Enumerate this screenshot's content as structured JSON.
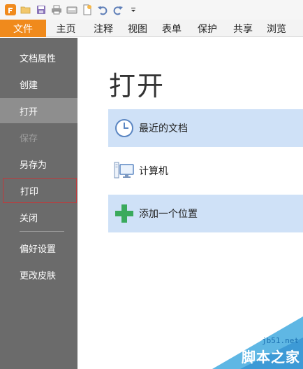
{
  "quick_access": {
    "icons": [
      "app-logo-icon",
      "open-folder-icon",
      "save-disk-icon",
      "print-icon",
      "scan-icon",
      "new-doc-icon",
      "undo-icon",
      "redo-icon",
      "customize-dropdown-icon"
    ]
  },
  "ribbon": {
    "tabs": [
      {
        "label": "文件",
        "active": true
      },
      {
        "label": "主页"
      },
      {
        "label": "注释"
      },
      {
        "label": "视图"
      },
      {
        "label": "表单"
      },
      {
        "label": "保护"
      },
      {
        "label": "共享"
      },
      {
        "label": "浏览"
      }
    ]
  },
  "sidebar": {
    "items": [
      {
        "label": "文档属性"
      },
      {
        "label": "创建"
      },
      {
        "label": "打开",
        "state": "active"
      },
      {
        "label": "保存",
        "state": "disabled"
      },
      {
        "label": "另存为"
      },
      {
        "label": "打印",
        "state": "highlighted"
      },
      {
        "label": "关闭"
      },
      {
        "label": "偏好设置"
      },
      {
        "label": "更改皮肤"
      }
    ]
  },
  "main": {
    "title": "打开",
    "options": [
      {
        "label": "最近的文档",
        "icon": "clock-icon"
      },
      {
        "label": "计算机",
        "icon": "computer-icon"
      },
      {
        "label": "添加一个位置",
        "icon": "plus-icon"
      }
    ]
  },
  "watermark": {
    "url": "jb51.net",
    "name": "脚本之家"
  },
  "colors": {
    "file_tab": "#f08a1c",
    "sidebar_bg": "#6b6b6b",
    "sidebar_active": "#8e8e8e",
    "option_highlight": "#cfe1f7",
    "plus_green": "#3aaa5c",
    "highlight_border": "#c0393b"
  }
}
